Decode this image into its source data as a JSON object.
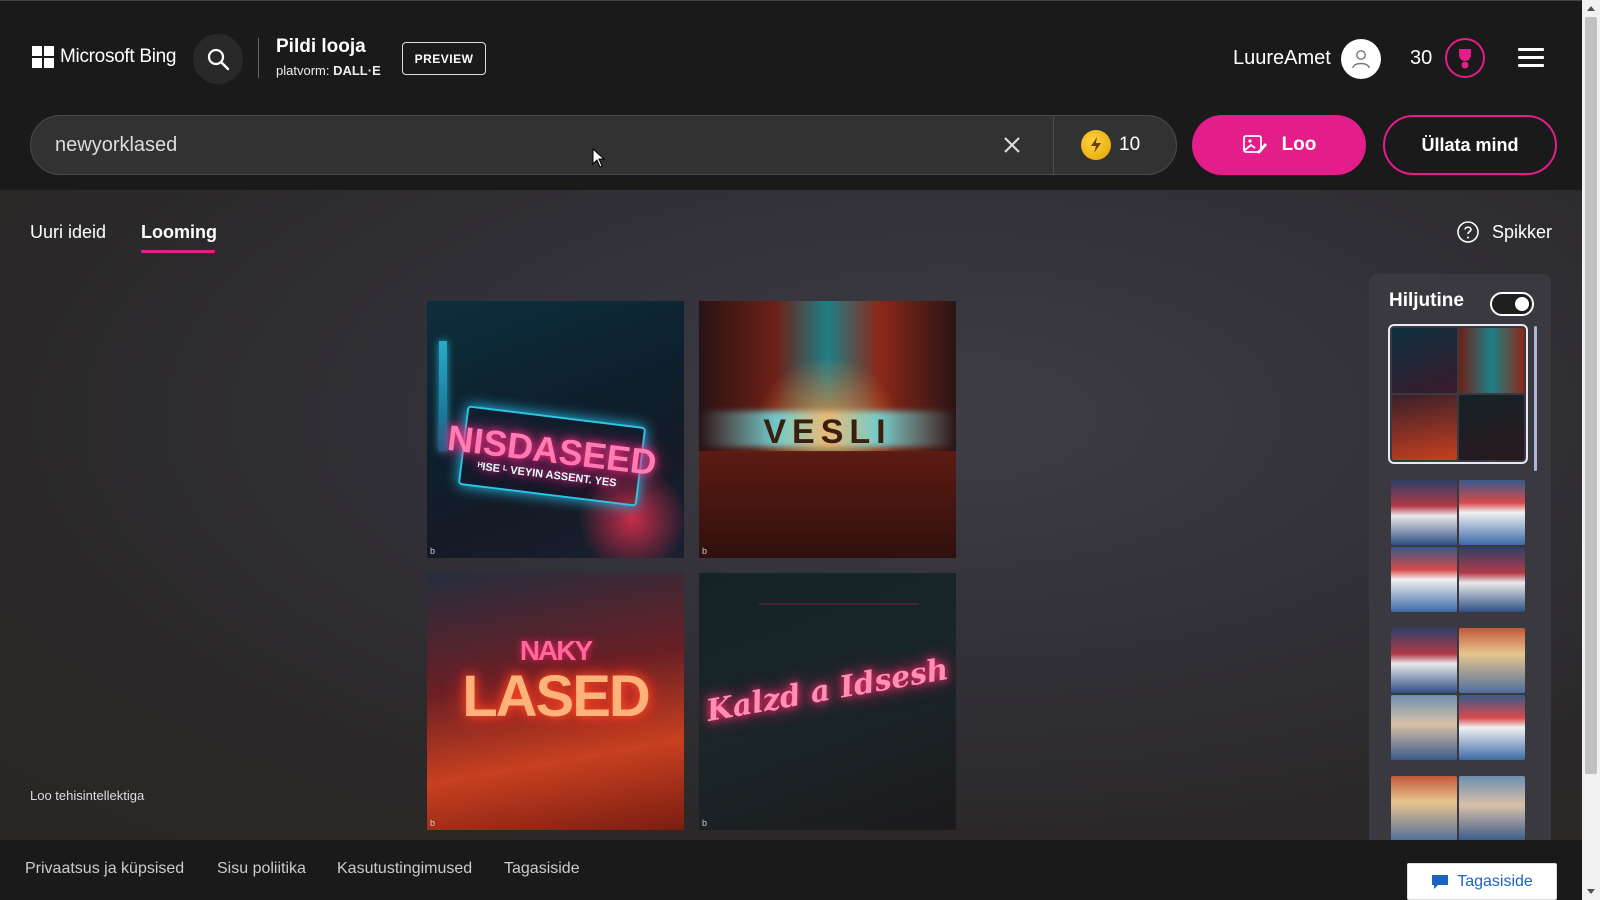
{
  "header": {
    "logo_text": "Microsoft Bing",
    "app_title": "Pildi looja",
    "platform_label": "platvorm:",
    "platform_name": "DALL·E",
    "preview_badge": "PREVIEW",
    "username": "LuureAmet",
    "reward_points": "30"
  },
  "search": {
    "value": "newyorklased",
    "boost_count": "10",
    "create_label": "Loo",
    "surprise_label": "Üllata mind"
  },
  "tabs": [
    {
      "label": "Uuri ideid",
      "active": false
    },
    {
      "label": "Looming",
      "active": true
    }
  ],
  "help_label": "Spikker",
  "images": [
    {
      "text": "NISDASEED",
      "subtext": "ᴴISE ᴸ VEYIN ASSENT. YES"
    },
    {
      "text": "VESLI",
      "subtext": ""
    },
    {
      "text": "LASED",
      "subtext": "NAKY"
    },
    {
      "text": "Kalzd a Idsesh",
      "subtext": ""
    }
  ],
  "recent": {
    "title": "Hiljutine",
    "toggle_on": true
  },
  "footer_note": "Loo tehisintellektiga",
  "footer_links": [
    "Privaatsus ja küpsised",
    "Sisu poliitika",
    "Kasutustingimused",
    "Tagasiside"
  ],
  "feedback_button": "Tagasiside",
  "colors": {
    "accent": "#e31d8a",
    "background": "#1b1a1a",
    "panel": "#3a3940"
  }
}
